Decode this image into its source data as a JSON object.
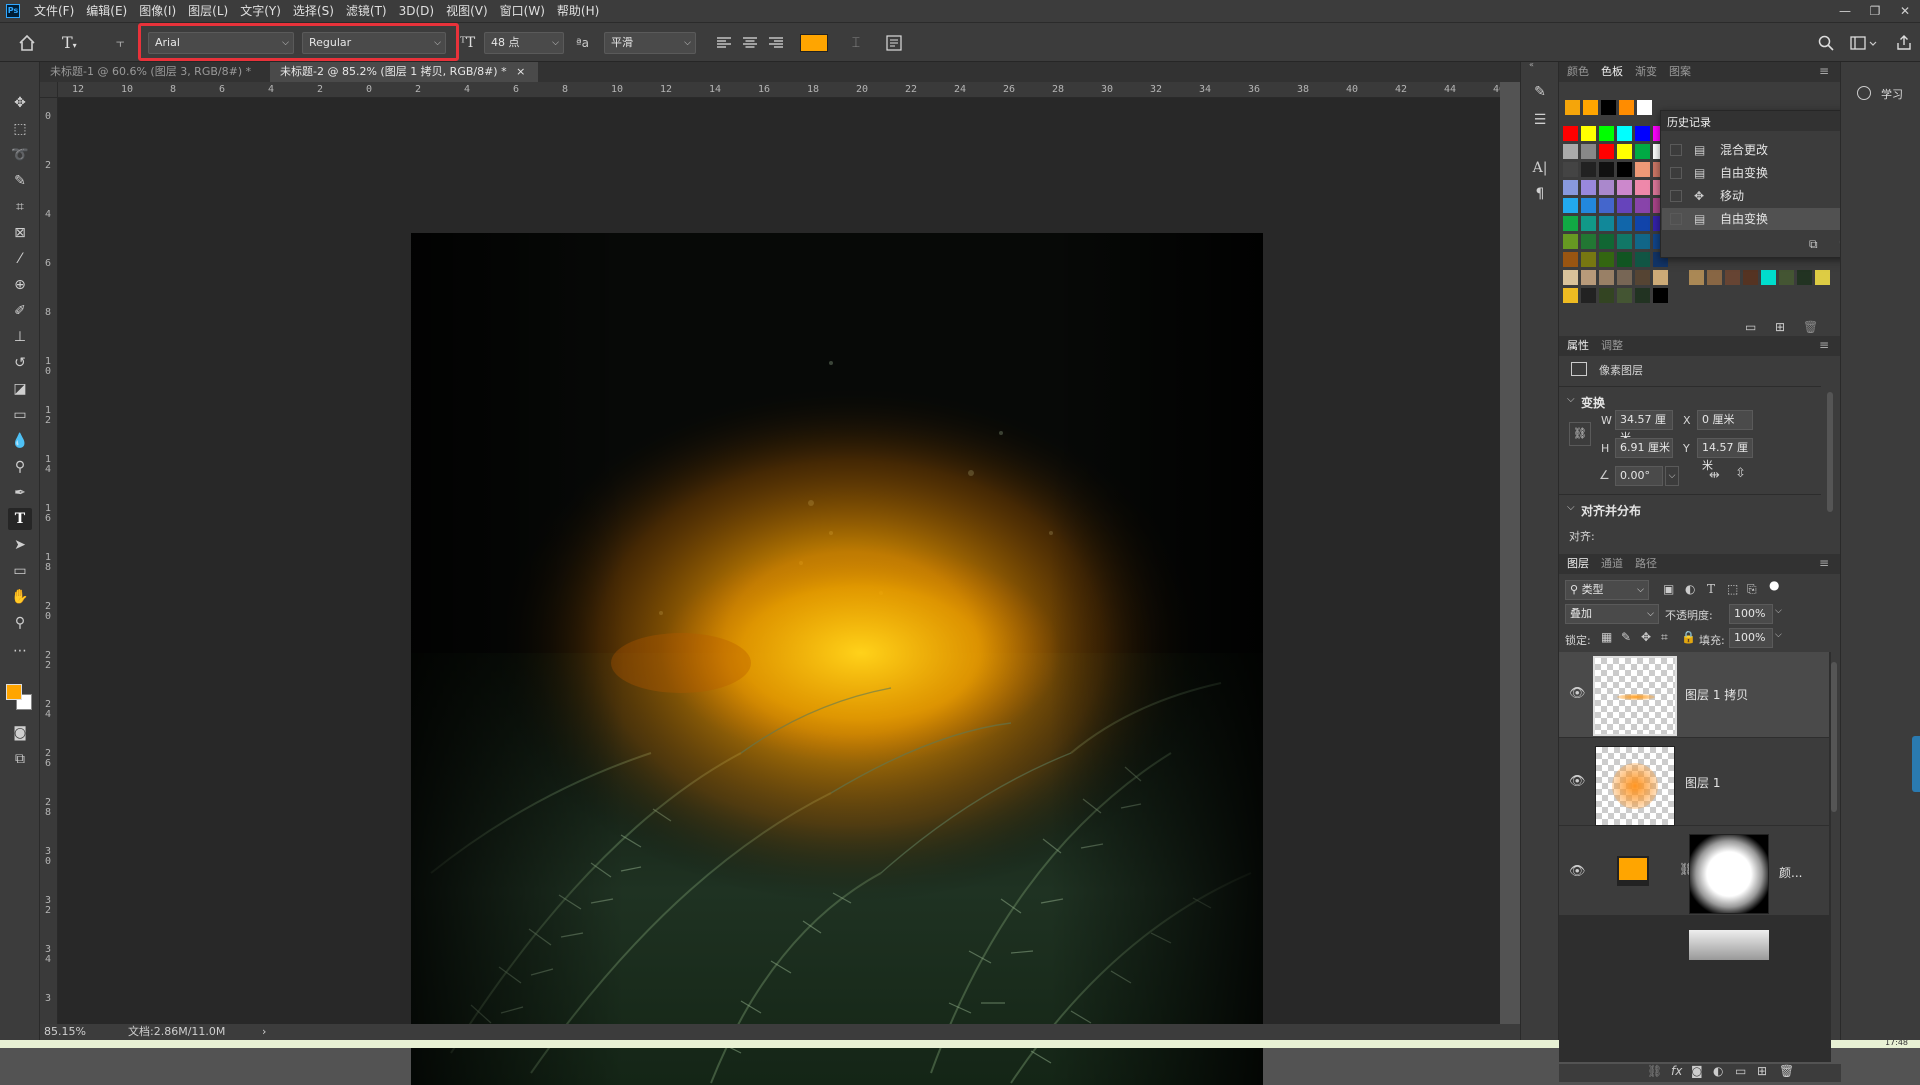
{
  "app": {
    "logo": "Ps"
  },
  "menu": [
    "文件(F)",
    "编辑(E)",
    "图像(I)",
    "图层(L)",
    "文字(Y)",
    "选择(S)",
    "滤镜(T)",
    "3D(D)",
    "视图(V)",
    "窗口(W)",
    "帮助(H)"
  ],
  "window_controls": {
    "minimize": "—",
    "restore": "❐",
    "close": "✕"
  },
  "options": {
    "font_family": "Arial",
    "font_style": "Regular",
    "font_size": "48 点",
    "aa_label": "ªa",
    "antialias": "平滑",
    "text_color": "#ffa500"
  },
  "doc_tabs": [
    {
      "label": "未标题-1 @ 60.6% (图层 3, RGB/8#) *",
      "close": "×"
    },
    {
      "label": "未标题-2 @ 85.2% (图层 1 拷贝, RGB/8#) *",
      "close": "×"
    }
  ],
  "ruler_h": [
    "12",
    "10",
    "8",
    "6",
    "4",
    "2",
    "0",
    "2",
    "4",
    "6",
    "8",
    "10",
    "12",
    "14",
    "16",
    "18",
    "20",
    "22",
    "24",
    "26",
    "28",
    "30",
    "32",
    "34",
    "36",
    "38",
    "40",
    "42",
    "44",
    "46"
  ],
  "ruler_v": [
    "0",
    "2",
    "4",
    "6",
    "8",
    "10",
    "12",
    "14",
    "16",
    "18",
    "20",
    "22",
    "24",
    "26",
    "28",
    "30",
    "32",
    "34",
    "3"
  ],
  "status": {
    "zoom": "85.15%",
    "doc": "文档:2.86M/11.0M",
    "arrow": "›"
  },
  "swatches_panel": {
    "tabs": [
      "颜色",
      "色板",
      "渐变",
      "图案"
    ],
    "recent": [
      "#f5a50a",
      "#ffa500",
      "#000000",
      "#ff8c00",
      "#ffffff"
    ],
    "grid": [
      [
        "#ff0000",
        "#ffff00",
        "#00ff00",
        "#00ffff",
        "#0000ff",
        "#ff00ff"
      ],
      [
        "#aaaaaa",
        "#888888",
        "#ff0000",
        "#ffff00",
        "#00aa44",
        "#ffffff"
      ],
      [
        "#444444",
        "#222222",
        "#111111",
        "#000000",
        "#ee9977",
        "#cc7766"
      ],
      [
        "#8899dd",
        "#9988dd",
        "#aa88cc",
        "#cc88cc",
        "#ee88aa",
        "#dd7799"
      ],
      [
        "#22aaee",
        "#2288dd",
        "#4466cc",
        "#6644bb",
        "#8844aa",
        "#aa4488"
      ],
      [
        "#11aa44",
        "#119988",
        "#118899",
        "#1166aa",
        "#1144aa",
        "#3322aa"
      ],
      [
        "#669922",
        "#227733",
        "#116633",
        "#117766",
        "#116688",
        "#114488"
      ],
      [
        "#995511",
        "#777711",
        "#336611",
        "#115522",
        "#115544",
        "#113366"
      ],
      [
        "#d9c29a",
        "#b89a7a",
        "#998066",
        "#776655",
        "#554433",
        "#ccaa77"
      ],
      [
        "#eebb22",
        "#222222",
        "#334422",
        "#445533",
        "#223322",
        "#000000"
      ]
    ],
    "grid_right_rows": [
      [
        "#aa8855",
        "#886644",
        "#664433",
        "#553322",
        "#00ddcc",
        "#445533",
        "#223322",
        "#ddcc44"
      ]
    ]
  },
  "history": {
    "title": "历史记录",
    "items": [
      {
        "label": "混合更改",
        "icon": "document-icon"
      },
      {
        "label": "自由变换",
        "icon": "document-icon"
      },
      {
        "label": "移动",
        "icon": "move-icon"
      },
      {
        "label": "自由变换",
        "icon": "document-icon",
        "selected": true
      }
    ]
  },
  "properties": {
    "tabs": [
      "属性",
      "调整"
    ],
    "type": "像素图层",
    "transform_title": "变换",
    "w_label": "W",
    "w": "34.57 厘米",
    "x_label": "X",
    "x": "0 厘米",
    "h_label": "H",
    "h": "6.91 厘米",
    "y_label": "Y",
    "y": "14.57 厘米",
    "angle": "0.00°",
    "align_title": "对齐并分布",
    "align_label": "对齐:"
  },
  "layers": {
    "tabs": [
      "图层",
      "通道",
      "路径"
    ],
    "filter": "类型",
    "blend": "叠加",
    "opacity_label": "不透明度:",
    "opacity": "100%",
    "lock_label": "锁定:",
    "fill_label": "填充:",
    "fill": "100%",
    "items": [
      {
        "name": "图层 1 拷贝"
      },
      {
        "name": "图层 1"
      },
      {
        "name": "颜..."
      }
    ]
  },
  "learn": {
    "label": "学习"
  },
  "clock": "17:48"
}
